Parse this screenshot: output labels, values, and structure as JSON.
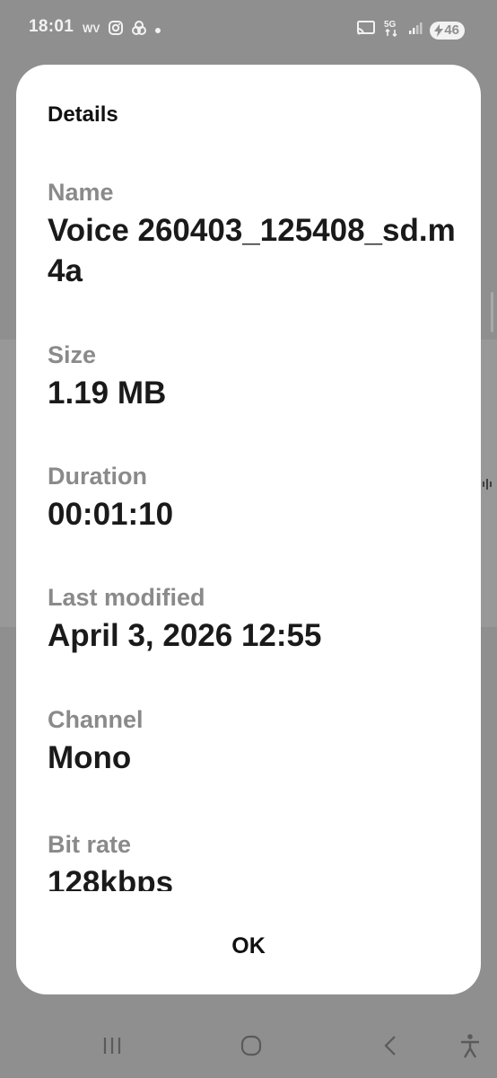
{
  "status_bar": {
    "time": "18:01",
    "battery_level": "46",
    "network_label": "5G"
  },
  "dialog": {
    "title": "Details",
    "fields": [
      {
        "label": "Name",
        "value": "Voice 260403_125408_sd.m4a"
      },
      {
        "label": "Size",
        "value": "1.19 MB"
      },
      {
        "label": "Duration",
        "value": "00:01:10"
      },
      {
        "label": "Last modified",
        "value": "April 3, 2026 12:55"
      },
      {
        "label": "Channel",
        "value": "Mono"
      },
      {
        "label": "Bit rate",
        "value": "128kbps"
      }
    ],
    "ok_label": "OK"
  },
  "icons": {
    "status_left": [
      "app-notification-icon",
      "instagram-icon",
      "threads-icon",
      "dot-icon"
    ],
    "status_right": [
      "cast-icon",
      "network-5g-icon",
      "signal-icon",
      "battery-icon"
    ],
    "navbar": [
      "recent-apps-icon",
      "home-icon",
      "back-icon",
      "accessibility-icon"
    ]
  },
  "colors": {
    "scrim": "#8f8f8f",
    "dialog_bg": "#ffffff",
    "label": "#8a8a8a",
    "value": "#1a1a1a"
  }
}
